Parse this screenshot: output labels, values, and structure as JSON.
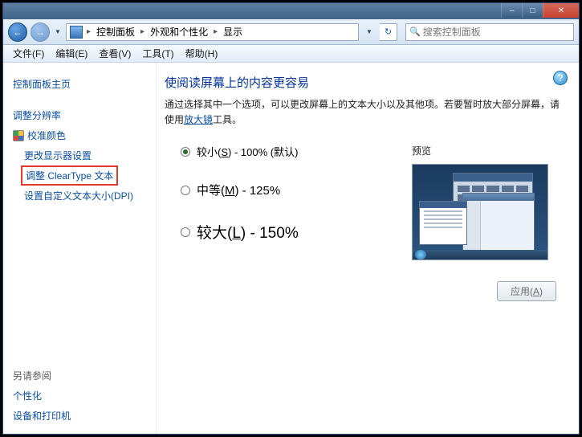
{
  "titlebar": {
    "minimize": "–",
    "maximize": "□",
    "close": "✕"
  },
  "nav": {
    "back_icon": "←",
    "fwd_icon": "→",
    "dropdown_icon": "▼",
    "breadcrumb": {
      "seg1": "控制面板",
      "seg2": "外观和个性化",
      "seg3": "显示",
      "arrow": "▸"
    },
    "refresh_icon": "↻",
    "search_placeholder": "搜索控制面板",
    "search_icon": "🔍"
  },
  "menubar": {
    "file": "文件(F)",
    "edit": "编辑(E)",
    "view": "查看(V)",
    "tools": "工具(T)",
    "help": "帮助(H)"
  },
  "sidebar": {
    "home": "控制面板主页",
    "resolution": "调整分辨率",
    "calibrate": "校准颜色",
    "display_settings": "更改显示器设置",
    "cleartype": "调整 ClearType 文本",
    "dpi": "设置自定义文本大小(DPI)",
    "see_also_header": "另请参阅",
    "see_also": {
      "personalization": "个性化",
      "devices": "设备和打印机"
    }
  },
  "content": {
    "help_icon": "?",
    "heading": "使阅读屏幕上的内容更容易",
    "desc_pre": "通过选择其中一个选项，可以更改屏幕上的文本大小以及其他项。若要暂时放大部分屏幕，请使用",
    "desc_link": "放大镜",
    "desc_post": "工具。",
    "options": {
      "small": {
        "label_pre": "较小(",
        "accel": "S",
        "label_post": ") - 100% (默认)"
      },
      "medium": {
        "label_pre": "中等(",
        "accel": "M",
        "label_post": ") - 125%"
      },
      "large": {
        "label_pre": "较大(",
        "accel": "L",
        "label_post": ") - 150%"
      }
    },
    "preview_label": "预览",
    "apply": {
      "label_pre": "应用(",
      "accel": "A",
      "label_post": ")"
    }
  }
}
